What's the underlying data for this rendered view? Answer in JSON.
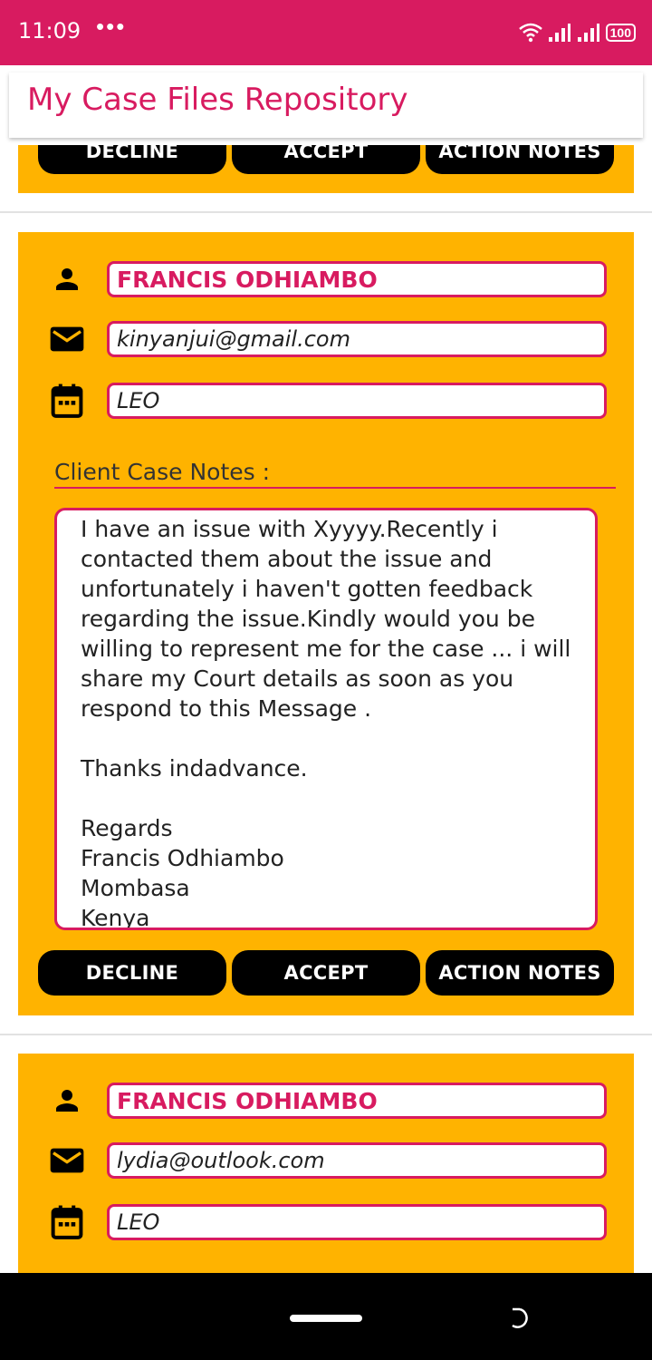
{
  "status_bar": {
    "time": "11:09",
    "dots": "•••",
    "battery": "100",
    "color": "#D81B60"
  },
  "app_bar": {
    "title": "My Case Files Repository"
  },
  "buttons": {
    "decline": "DECLINE",
    "accept": "ACCEPT",
    "action_notes": "ACTION NOTES"
  },
  "cases": [
    {
      "name": "FRANCIS ODHIAMBO",
      "email": "kinyanjui@gmail.com",
      "date": "LEO",
      "notes_label": "Client Case Notes :",
      "notes": "I have an issue with Xyyyy.Recently i contacted them about the issue and unfortunately i haven't gotten feedback regarding the issue.Kindly would you be willing to represent me for the case ... i will share my Court details as soon as you respond to this Message .\n\nThanks indadvance.\n\nRegards\nFrancis Odhiambo\nMombasa\nKenya"
    },
    {
      "name": "FRANCIS ODHIAMBO",
      "email": "lydia@outlook.com",
      "date": "LEO"
    }
  ],
  "colors": {
    "card_bg": "#FFB300",
    "accent": "#D81B60",
    "button_bg": "#000000"
  }
}
